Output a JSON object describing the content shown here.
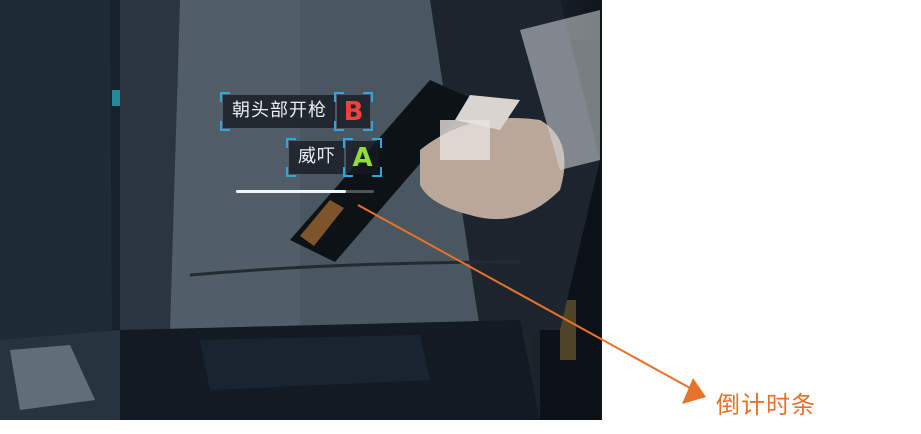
{
  "hud": {
    "option_b": {
      "label": "朝头部开枪",
      "key": "B",
      "key_color": "#f0413a"
    },
    "option_a": {
      "label": "威吓",
      "key": "A",
      "key_color": "#8fdc3a"
    },
    "timer": {
      "progress": 0.8
    }
  },
  "annotation": {
    "label": "倒计时条",
    "color": "#e8712b"
  }
}
